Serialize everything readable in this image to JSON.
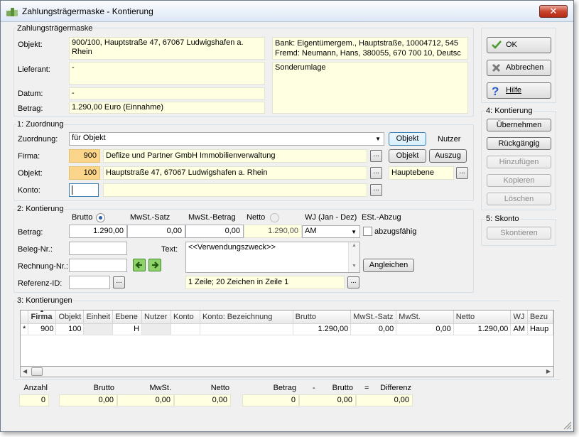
{
  "window": {
    "title": "Zahlungsträgermaske - Kontierung",
    "close": "✕"
  },
  "header": {
    "group_title": "Zahlungsträgermaske",
    "objekt_label": "Objekt:",
    "objekt_value": "900/100,  Hauptstraße 47, 67067 Ludwigshafen a. Rhein",
    "lieferant_label": "Lieferant:",
    "lieferant_value": "-",
    "datum_label": "Datum:",
    "datum_value": "-",
    "betrag_label": "Betrag:",
    "betrag_value": "1.290,00  Euro  (Einnahme)",
    "bank_value": "Bank: Eigentümergem., Hauptstraße,  10004712,  545",
    "fremd_value": "Fremd: Neumann, Hans,  380055,  670 700 10,  Deutsc",
    "note_value": "Sonderumlage"
  },
  "buttons": {
    "ok": "OK",
    "abbrechen": "Abbrechen",
    "hilfe": "Hilfe"
  },
  "kontierung_panel": {
    "title": "4: Kontierung",
    "uebernehmen": "Übernehmen",
    "rueckgaengig": "Rückgängig",
    "hinzufuegen": "Hinzufügen",
    "kopieren": "Kopieren",
    "loeschen": "Löschen"
  },
  "skonto_panel": {
    "title": "5: Skonto",
    "skontieren": "Skontieren"
  },
  "zuordnung": {
    "title": "1: Zuordnung",
    "zuordnung_label": "Zuordnung:",
    "zuordnung_value": "für Objekt",
    "tab_objekt": "Objekt",
    "tab_nutzer": "Nutzer",
    "firma_label": "Firma:",
    "firma_nr": "900",
    "firma_name": "Deflize und Partner GmbH Immobilienverwaltung",
    "objekt_btn": "Objekt",
    "auszug_btn": "Auszug",
    "objekt_label": "Objekt:",
    "objekt_nr": "100",
    "objekt_name": "Hauptstraße 47, 67067 Ludwigshafen a. Rhein",
    "ebene_value": "Hauptebene",
    "konto_label": "Konto:",
    "konto_value": "",
    "dots": "..."
  },
  "kontierung": {
    "title": "2: Kontierung",
    "brutto_hdr": "Brutto",
    "mwst_satz_hdr": "MwSt.-Satz",
    "mwst_betrag_hdr": "MwSt.-Betrag",
    "netto_hdr": "Netto",
    "wj_hdr": "WJ  (Jan - Dez)",
    "est_hdr": "ESt.-Abzug",
    "betrag_label": "Betrag:",
    "brutto_value": "1.290,00",
    "mwst_satz_value": "0,00",
    "mwst_betrag_value": "0,00",
    "netto_value": "1.290,00",
    "wj_value": "AM",
    "abzug_label": "abzugsfähig",
    "beleg_label": "Beleg-Nr.:",
    "beleg_value": "",
    "text_label": "Text:",
    "text_value": "<<Verwendungszweck>>",
    "rechnung_label": "Rechnung-Nr.:",
    "rechnung_value": "",
    "angleichen": "Angleichen",
    "referenz_label": "Referenz-ID:",
    "referenz_value": "",
    "zeilen_info": "1 Zeile; 20 Zeichen in Zeile 1"
  },
  "kontierungen": {
    "title": "3: Kontierungen",
    "columns": [
      "",
      "Firma",
      "Objekt",
      "Einheit",
      "Ebene",
      "Nutzer",
      "Konto",
      "Konto: Bezeichnung",
      "Brutto",
      "MwSt.-Satz",
      "MwSt.",
      "Netto",
      "WJ",
      "Bezu"
    ],
    "rows": [
      [
        "*",
        "900",
        "100",
        "",
        "H",
        "",
        "",
        "",
        "1.290,00",
        "0,00",
        "0,00",
        "1.290,00",
        "AM",
        "Haup"
      ]
    ]
  },
  "summary": {
    "anzahl_label": "Anzahl",
    "brutto_label": "Brutto",
    "mwst_label": "MwSt.",
    "netto_label": "Netto",
    "betrag_label": "Betrag",
    "minus": "-",
    "brutto2_label": "Brutto",
    "eq": "=",
    "differenz_label": "Differenz",
    "anzahl": "0",
    "brutto": "0,00",
    "mwst": "0,00",
    "netto": "0,00",
    "betrag": "0",
    "brutto2": "0,00",
    "differenz": "0,00"
  }
}
